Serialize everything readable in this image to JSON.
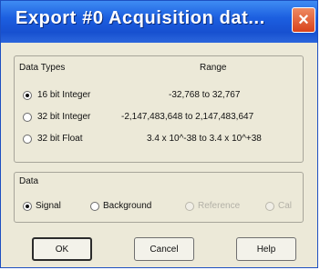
{
  "window": {
    "title": "Export #0  Acquisition dat...",
    "close_glyph": "×"
  },
  "data_types": {
    "header_types": "Data Types",
    "header_range": "Range",
    "options": [
      {
        "label": "16 bit Integer",
        "range": "-32,768  to  32,767",
        "selected": true
      },
      {
        "label": "32 bit Integer",
        "range": "-2,147,483,648  to 2,147,483,647",
        "selected": false
      },
      {
        "label": "32 bit Float",
        "range": "3.4 x 10^-38  to  3.4 x 10^+38",
        "selected": false
      }
    ]
  },
  "data": {
    "legend": "Data",
    "options": [
      {
        "label": "Signal",
        "selected": true,
        "enabled": true
      },
      {
        "label": "Background",
        "selected": false,
        "enabled": true
      },
      {
        "label": "Reference",
        "selected": false,
        "enabled": false
      },
      {
        "label": "Cal",
        "selected": false,
        "enabled": false
      }
    ]
  },
  "buttons": {
    "ok": "OK",
    "cancel": "Cancel",
    "help": "Help"
  },
  "icons": {
    "close": "close-icon",
    "radio": "radio-button"
  },
  "colors": {
    "title_bar": "#1c5fe0",
    "dialog_bg": "#ece9d8",
    "close_button": "#d8421c"
  }
}
